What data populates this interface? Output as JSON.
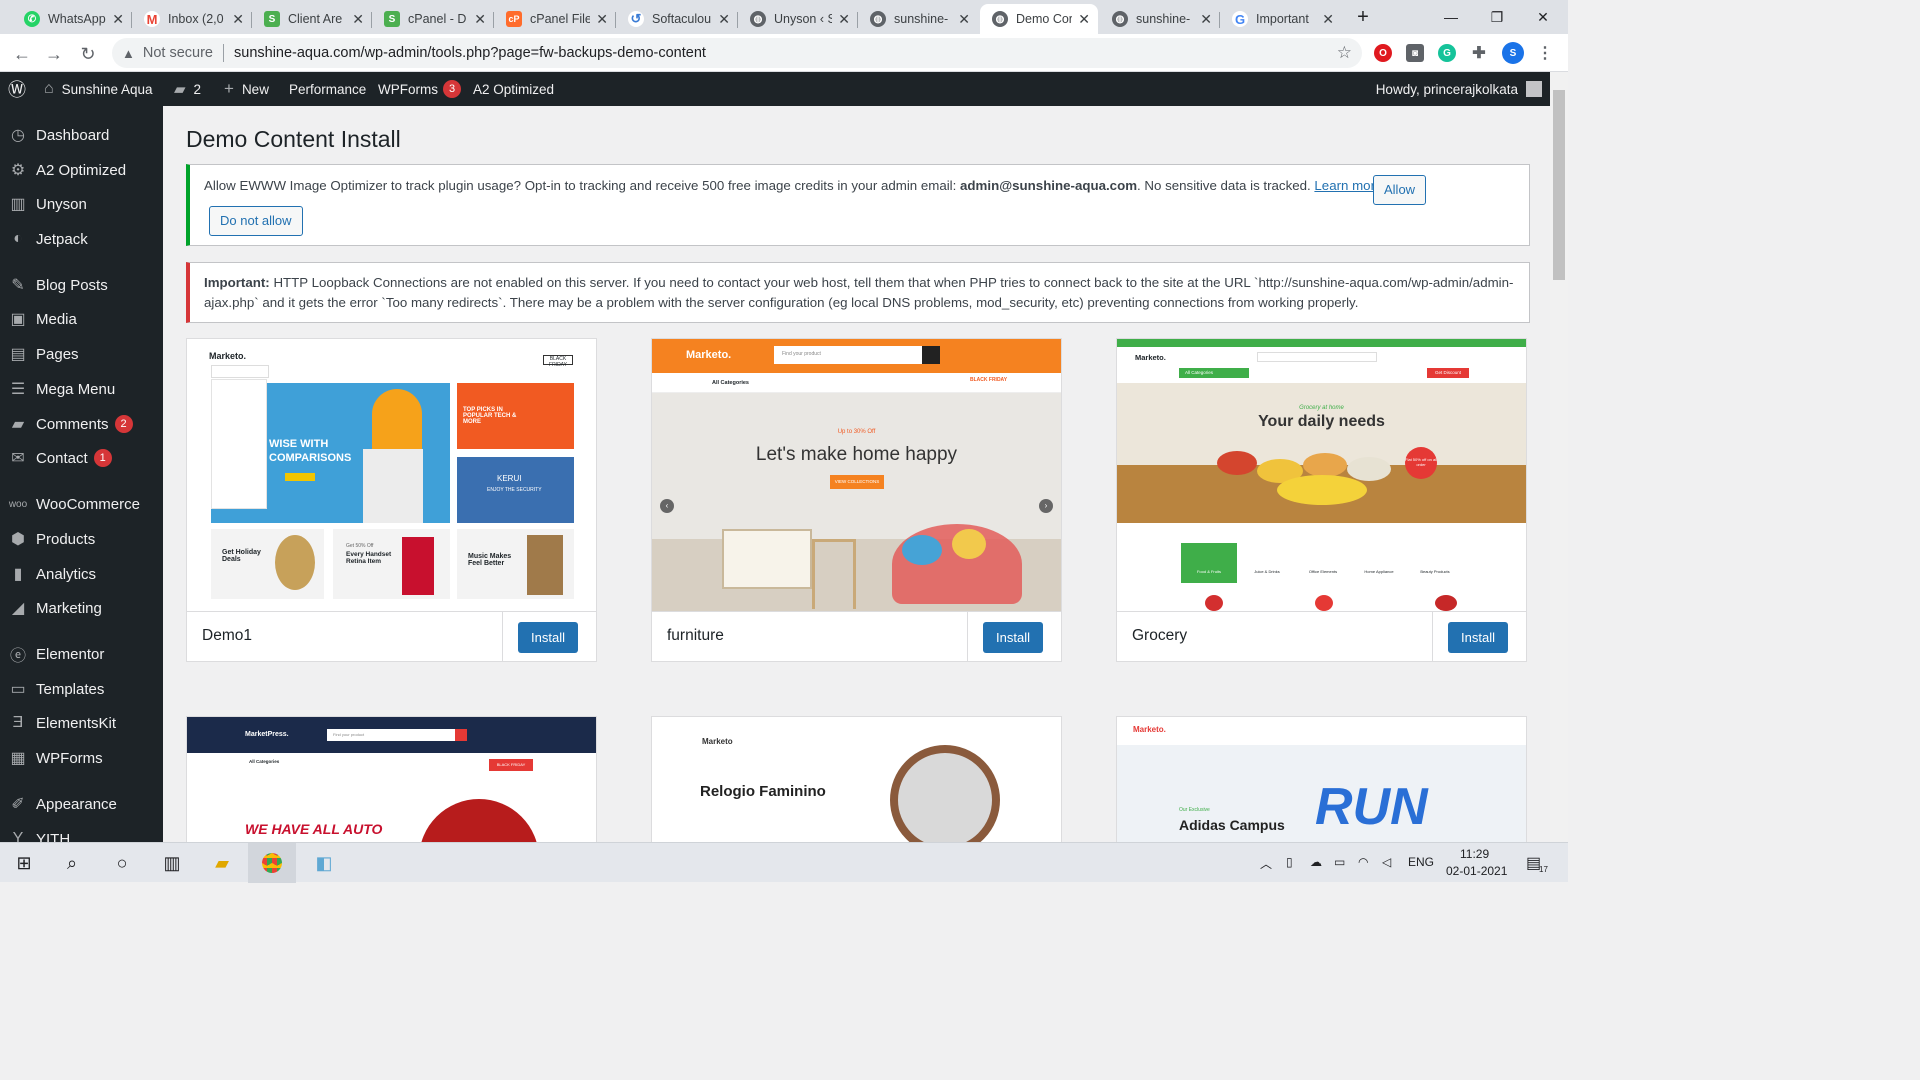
{
  "browser": {
    "tabs": [
      {
        "label": "WhatsApp",
        "icon": "whatsapp-icon",
        "color": "#25d366"
      },
      {
        "label": "Inbox (2,0",
        "icon": "gmail-icon",
        "color": "#ea4335"
      },
      {
        "label": "Client Are",
        "icon": "a2-icon",
        "color": "#4caf50"
      },
      {
        "label": "cPanel - D",
        "icon": "cpanel-leaf-icon",
        "color": "#4caf50"
      },
      {
        "label": "cPanel File",
        "icon": "cpanel-icon",
        "color": "#ff6c2c"
      },
      {
        "label": "Softaculou",
        "icon": "softaculous-icon",
        "color": "#3a7bd5"
      },
      {
        "label": "Unyson ‹ S",
        "icon": "globe-icon",
        "color": "#5f6368"
      },
      {
        "label": "sunshine-",
        "icon": "globe-icon",
        "color": "#5f6368"
      },
      {
        "label": "Demo Cor",
        "icon": "globe-icon",
        "color": "#5f6368"
      },
      {
        "label": "sunshine-",
        "icon": "globe-icon",
        "color": "#5f6368"
      },
      {
        "label": "Important",
        "icon": "google-icon",
        "color": "#4285f4"
      }
    ],
    "address": {
      "security": "Not secure",
      "url": "sunshine-aqua.com/wp-admin/tools.php?page=fw-backups-demo-content"
    }
  },
  "adminbar": {
    "site_name": "Sunshine Aqua",
    "comments_count": "2",
    "new_label": "New",
    "performance_label": "Performance",
    "wpforms_label": "WPForms",
    "wpforms_badge": "3",
    "a2_label": "A2 Optimized",
    "howdy": "Howdy, princerajkolkata"
  },
  "sidebar": {
    "items": [
      {
        "label": "Dashboard",
        "icon": "dashboard-icon"
      },
      {
        "label": "A2 Optimized",
        "icon": "gear-icon"
      },
      {
        "label": "Unyson",
        "icon": "unyson-icon"
      },
      {
        "label": "Jetpack",
        "icon": "jetpack-icon"
      },
      {
        "label": "Blog Posts",
        "icon": "pin-icon"
      },
      {
        "label": "Media",
        "icon": "media-icon"
      },
      {
        "label": "Pages",
        "icon": "pages-icon"
      },
      {
        "label": "Mega Menu",
        "icon": "menu-icon"
      },
      {
        "label": "Comments",
        "icon": "comments-icon",
        "badge": "2"
      },
      {
        "label": "Contact",
        "icon": "mail-icon",
        "badge": "1"
      },
      {
        "label": "WooCommerce",
        "icon": "woo-icon"
      },
      {
        "label": "Products",
        "icon": "products-icon"
      },
      {
        "label": "Analytics",
        "icon": "analytics-icon"
      },
      {
        "label": "Marketing",
        "icon": "marketing-icon"
      },
      {
        "label": "Elementor",
        "icon": "elementor-icon"
      },
      {
        "label": "Templates",
        "icon": "folder-icon"
      },
      {
        "label": "ElementsKit",
        "icon": "elementskit-icon"
      },
      {
        "label": "WPForms",
        "icon": "wpforms-icon"
      },
      {
        "label": "Appearance",
        "icon": "brush-icon"
      },
      {
        "label": "YITH",
        "icon": "yith-icon"
      }
    ]
  },
  "main": {
    "title": "Demo Content Install",
    "notice_tracking": {
      "text_before": "Allow EWWW Image Optimizer to track plugin usage? Opt-in to tracking and receive 500 free image credits in your admin email: ",
      "email": "admin@sunshine-aqua.com",
      "text_after": ". No sensitive data is tracked. ",
      "learn_more": "Learn more.",
      "allow_button": "Allow",
      "deny_button": "Do not allow"
    },
    "notice_loopback": {
      "strong": "Important:",
      "text": " HTTP Loopback Connections are not enabled on this server. If you need to contact your web host, tell them that when PHP tries to connect back to the site at the URL `http://sunshine-aqua.com/wp-admin/admin-ajax.php` and it gets the error `Too many redirects`. There may be a problem with the server configuration (eg local DNS problems, mod_security, etc) preventing connections from working properly."
    },
    "demos": [
      {
        "name": "Demo1",
        "install_label": "Install",
        "preview": {
          "brand": "Marketo.",
          "hero": "WISE WITH COMPARISONS",
          "promo1": "TOP PICKS IN POPULAR TECH & MORE",
          "promo2": "KERUI",
          "promo2_sub": "ENJOY THE SECURITY",
          "tile1": "Get Holiday Deals",
          "tile2": "Every Handset Retina Item",
          "tile2_pre": "Get 50% Off",
          "tile3": "Music Makes Feel Better",
          "badge": "BLACK FRIDAY"
        }
      },
      {
        "name": "furniture",
        "install_label": "Install",
        "preview": {
          "brand": "Marketo.",
          "search": "Find your product",
          "cats": "All Categories",
          "eyebrow": "Up to 30% Off",
          "headline": "Let's make home happy",
          "cta": "VIEW COLLECTIONS",
          "badge": "BLACK FRIDAY"
        }
      },
      {
        "name": "Grocery",
        "install_label": "Install",
        "preview": {
          "brand": "Marketo.",
          "cats": "All Categories",
          "eyebrow": "Grocery at home",
          "headline": "Your daily needs",
          "sale": "Flat 50% off on all order",
          "c1": "Food & Fruits",
          "c2": "Juice & Drinks",
          "c3": "Office Elements",
          "c4": "Home Appliance",
          "c5": "Beauty Products",
          "discount_btn": "Get Discount"
        }
      },
      {
        "preview": {
          "brand": "MarketPress.",
          "search": "Find your product",
          "cats": "All Categories",
          "badge": "BLACK FRIDAY",
          "headline": "WE HAVE ALL AUTO"
        }
      },
      {
        "preview": {
          "brand": "Marketo",
          "headline": "Relogio Faminino"
        }
      },
      {
        "preview": {
          "brand": "Marketo.",
          "eyebrow": "Our Exclusive",
          "headline": "Adidas Campus",
          "word": "RUN"
        }
      }
    ]
  },
  "taskbar": {
    "lang": "ENG",
    "time": "11:29",
    "date": "02-01-2021",
    "notif_count": "17"
  }
}
